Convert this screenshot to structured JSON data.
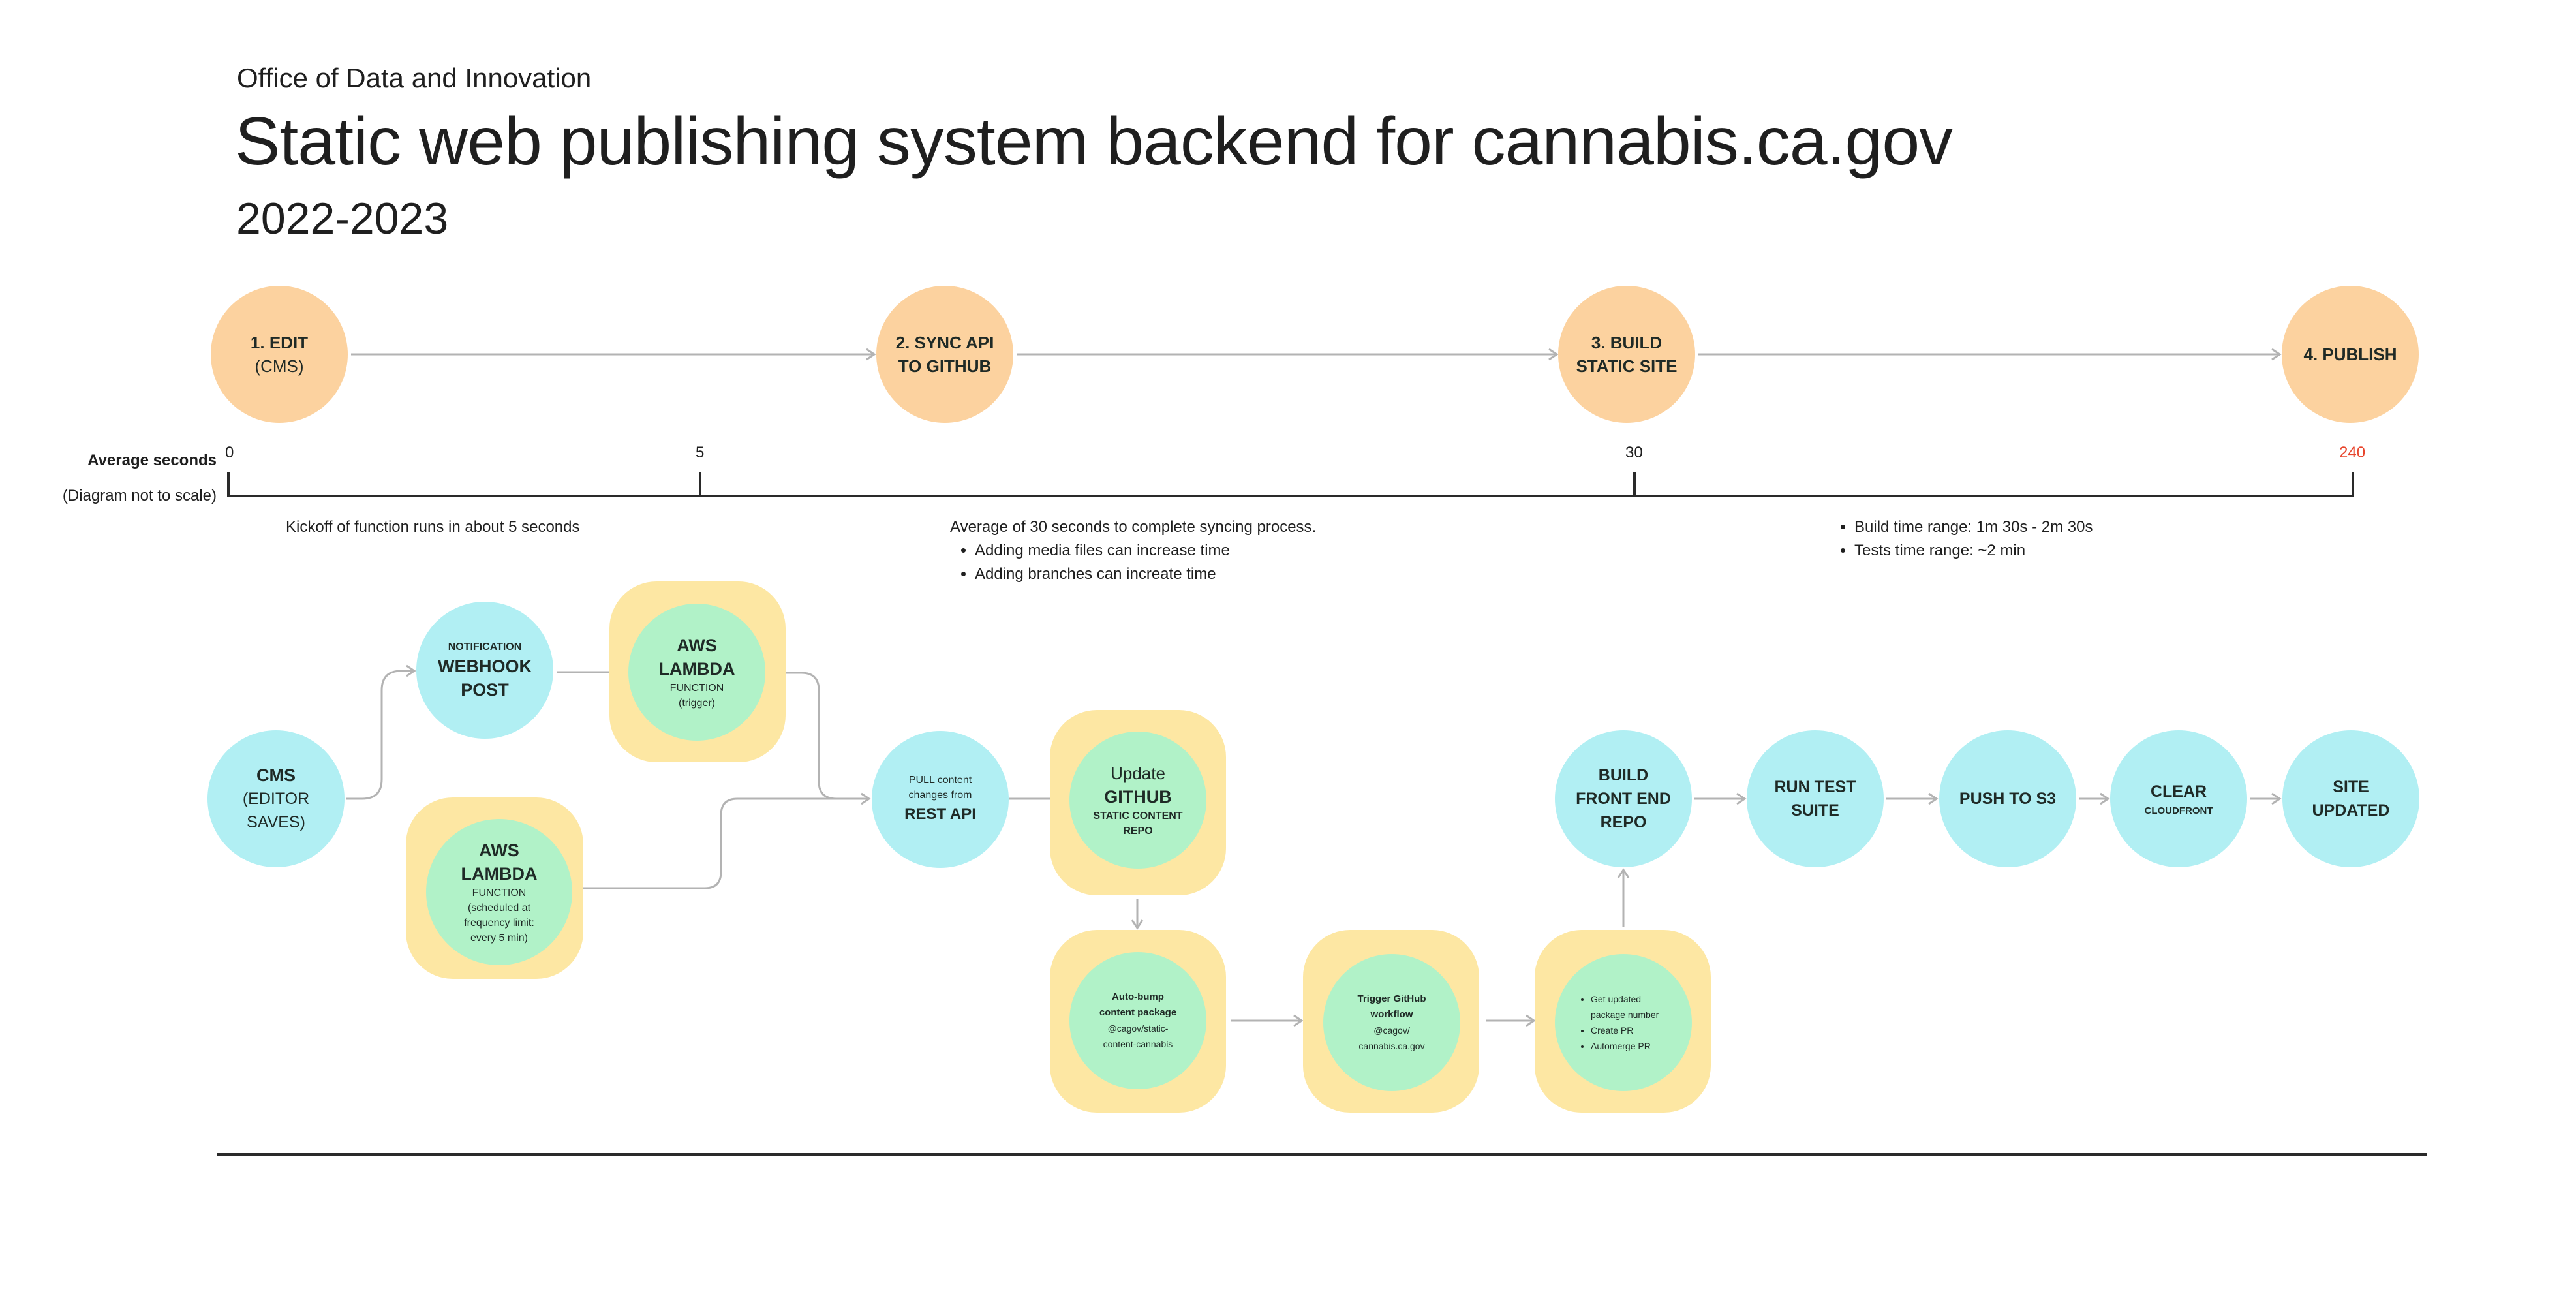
{
  "header": {
    "organization": "Office of Data and Innovation",
    "title": "Static web publishing system backend for cannabis.ca.gov",
    "years": "2022-2023"
  },
  "phases": [
    {
      "line1": "1. EDIT",
      "line2": "(CMS)"
    },
    {
      "line1": "2. SYNC API",
      "line2": "TO GITHUB"
    },
    {
      "line1": "3. BUILD",
      "line2": "STATIC SITE"
    },
    {
      "line1": "4. PUBLISH",
      "line2": ""
    }
  ],
  "timeline": {
    "label": "Average seconds",
    "sublabel": "(Diagram not to scale)",
    "ticks": [
      "0",
      "5",
      "30",
      "240"
    ],
    "highlight_color": "#e8452c",
    "notes": {
      "kickoff": "Kickoff of function runs in about 5 seconds",
      "sync_heading": "Average of 30 seconds to complete syncing process.",
      "sync_bullets": [
        "Adding media files can increase time",
        "Adding branches can increate time"
      ],
      "build_bullets": [
        "Build time range: 1m 30s - 2m 30s",
        "Tests time range: ~2 min"
      ]
    }
  },
  "nodes": {
    "cms": {
      "title": "CMS",
      "line2": "(EDITOR",
      "line3": "SAVES)"
    },
    "webhook": {
      "pre": "NOTIFICATION",
      "title1": "WEBHOOK",
      "title2": "POST"
    },
    "lambda_trigger": {
      "title1": "AWS",
      "title2": "LAMBDA",
      "sub1": "FUNCTION",
      "sub2": "(trigger)"
    },
    "lambda_scheduled": {
      "title1": "AWS",
      "title2": "LAMBDA",
      "sub1": "FUNCTION",
      "sub2": "(scheduled at",
      "sub3": "frequency limit:",
      "sub4": "every 5 min)"
    },
    "rest_api": {
      "pre1": "PULL content",
      "pre2": "changes from",
      "title": "REST API"
    },
    "github": {
      "pre": "Update",
      "title": "GITHUB",
      "sub1": "STATIC CONTENT",
      "sub2": "REPO"
    },
    "autobump": {
      "title1": "Auto-bump",
      "title2": "content package",
      "sub1": "@cagov/static-",
      "sub2": "content-cannabis"
    },
    "trigger_workflow": {
      "title1": "Trigger GitHub",
      "title2": "workflow",
      "sub1": "@cagov/",
      "sub2": "cannabis.ca.gov"
    },
    "update_steps": {
      "bullets": [
        "Get updated package number",
        "Create PR",
        "Automerge PR"
      ]
    },
    "build_frontend": {
      "line1": "BUILD",
      "line2": "FRONT END",
      "line3": "REPO"
    },
    "run_tests": {
      "line1": "RUN TEST",
      "line2": "SUITE"
    },
    "push_s3": {
      "line1": "PUSH TO S3"
    },
    "clear_cloudfront": {
      "line1": "CLEAR",
      "line2": "CLOUDFRONT"
    },
    "site_updated": {
      "line1": "SITE",
      "line2": "UPDATED"
    }
  },
  "colors": {
    "phase": "#fcd29f",
    "service": "#b1eff3",
    "function": "#b1f2c8",
    "container": "#fde7a3",
    "connector": "#b3b3b3"
  }
}
